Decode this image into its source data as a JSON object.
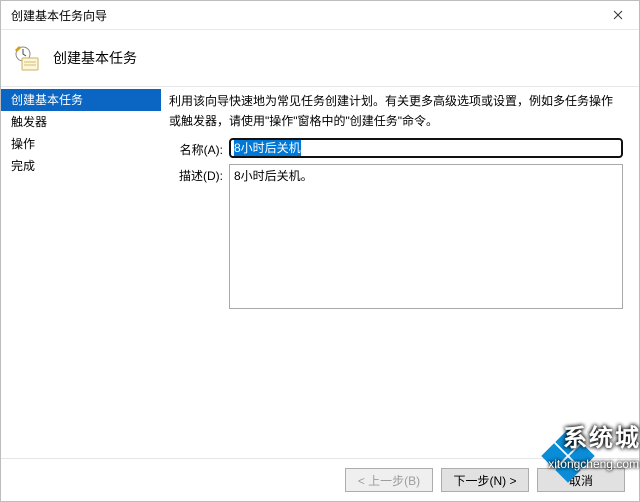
{
  "window": {
    "title": "创建基本任务向导"
  },
  "header": {
    "title": "创建基本任务"
  },
  "nav": {
    "items": [
      {
        "label": "创建基本任务",
        "active": true
      },
      {
        "label": "触发器",
        "active": false
      },
      {
        "label": "操作",
        "active": false
      },
      {
        "label": "完成",
        "active": false
      }
    ]
  },
  "content": {
    "intro": "利用该向导快速地为常见任务创建计划。有关更多高级选项或设置，例如多任务操作或触发器，请使用\"操作\"窗格中的\"创建任务\"命令。",
    "name_label": "名称(A):",
    "name_value": "8小时后关机",
    "desc_label": "描述(D):",
    "desc_value": "8小时后关机。"
  },
  "footer": {
    "back": "< 上一步(B)",
    "next": "下一步(N) >",
    "cancel": "取消"
  },
  "watermark": {
    "brand": "系统城",
    "url": "xitongcheng.com"
  }
}
